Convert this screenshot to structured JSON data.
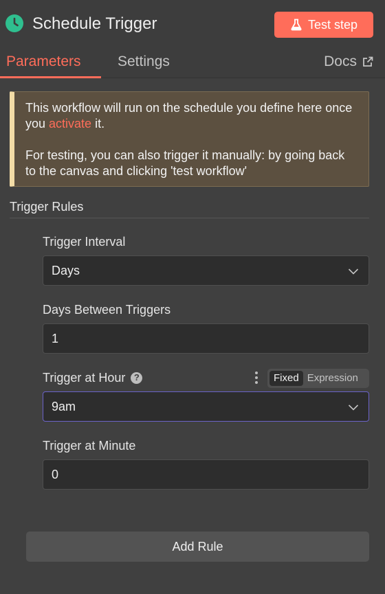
{
  "header": {
    "title": "Schedule Trigger",
    "test_button_label": "Test step",
    "node_icon": "clock-icon",
    "test_icon": "flask-icon"
  },
  "tabs": {
    "items": [
      {
        "label": "Parameters",
        "active": true
      },
      {
        "label": "Settings",
        "active": false
      }
    ],
    "docs_label": "Docs",
    "docs_icon": "external-link-icon"
  },
  "notice": {
    "line1_before": "This workflow will run on the schedule you define here once you ",
    "link_text": "activate",
    "line1_after": " it.",
    "line2": "For testing, you can also trigger it manually: by going back to the canvas and clicking 'test workflow'"
  },
  "trigger_rules": {
    "section_title": "Trigger Rules",
    "fields": {
      "interval": {
        "label": "Trigger Interval",
        "value": "Days"
      },
      "days_between": {
        "label": "Days Between Triggers",
        "value": "1"
      },
      "hour": {
        "label": "Trigger at Hour",
        "value": "9am",
        "mode_options": [
          "Fixed",
          "Expression"
        ],
        "selected_mode": "Fixed"
      },
      "minute": {
        "label": "Trigger at Minute",
        "value": "0"
      }
    },
    "add_rule_label": "Add Rule"
  },
  "colors": {
    "accent": "#ff6d5a",
    "node_icon": "#2fbf8f",
    "notice_bg": "#5c5040",
    "notice_border": "#f3dca6",
    "focus_border": "#6b63c9"
  }
}
